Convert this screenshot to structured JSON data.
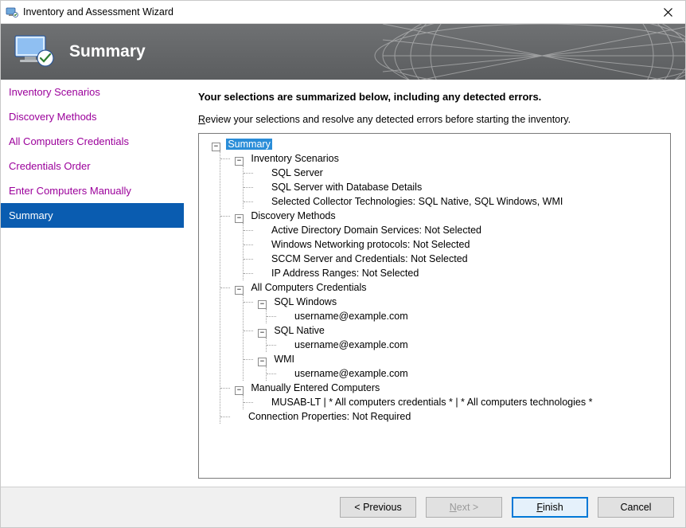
{
  "window": {
    "title": "Inventory and Assessment Wizard"
  },
  "banner": {
    "title": "Summary"
  },
  "sidebar": {
    "items": [
      {
        "label": "Inventory Scenarios",
        "state": "visited"
      },
      {
        "label": "Discovery Methods",
        "state": "visited"
      },
      {
        "label": "All Computers Credentials",
        "state": "visited"
      },
      {
        "label": "Credentials Order",
        "state": "visited"
      },
      {
        "label": "Enter Computers Manually",
        "state": "visited"
      },
      {
        "label": "Summary",
        "state": "selected"
      }
    ]
  },
  "content": {
    "headline": "Your selections are summarized below, including any detected errors.",
    "subtext_pre": "R",
    "subtext_rest": "eview your selections and resolve any detected errors before starting the inventory."
  },
  "tree": {
    "root": {
      "label": "Summary",
      "children": [
        {
          "label": "Inventory Scenarios",
          "children": [
            {
              "label": "SQL Server"
            },
            {
              "label": "SQL Server with Database Details"
            },
            {
              "label": "Selected Collector Technologies: SQL Native, SQL Windows, WMI"
            }
          ]
        },
        {
          "label": "Discovery Methods",
          "children": [
            {
              "label": "Active Directory Domain Services: Not Selected"
            },
            {
              "label": "Windows Networking protocols: Not Selected"
            },
            {
              "label": "SCCM Server and Credentials: Not Selected"
            },
            {
              "label": "IP Address Ranges: Not Selected"
            }
          ]
        },
        {
          "label": "All Computers Credentials",
          "children": [
            {
              "label": "SQL Windows",
              "children": [
                {
                  "label": "username@example.com"
                }
              ]
            },
            {
              "label": "SQL Native",
              "children": [
                {
                  "label": "username@example.com"
                }
              ]
            },
            {
              "label": "WMI",
              "children": [
                {
                  "label": "username@example.com"
                }
              ]
            }
          ]
        },
        {
          "label": "Manually Entered Computers",
          "children": [
            {
              "label": "MUSAB-LT | * All computers credentials * | * All computers technologies *"
            }
          ]
        },
        {
          "label": "Connection Properties: Not Required"
        }
      ]
    }
  },
  "footer": {
    "previous": "< Previous",
    "next_pre": "N",
    "next_rest": "ext >",
    "finish_pre": "F",
    "finish_rest": "inish",
    "cancel": "Cancel",
    "next_enabled": false
  }
}
